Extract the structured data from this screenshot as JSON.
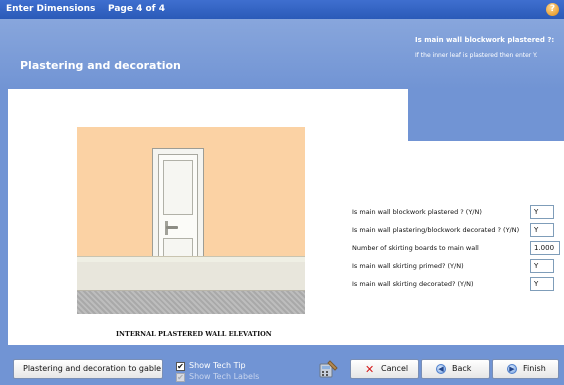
{
  "window": {
    "title": "Enter Dimensions",
    "page_indicator": "Page 4 of 4",
    "help_label": "?"
  },
  "header": {
    "section_title": "Plastering and decoration",
    "tip_title": "Is main wall blockwork plastered ?:",
    "tip_text": "If the inner leaf is plastered then enter Y."
  },
  "illustration": {
    "caption": "INTERNAL PLASTERED WALL ELEVATION",
    "wall_color": "#fbd2a4"
  },
  "form": {
    "rows": [
      {
        "label": "Is main wall blockwork plastered ? (Y/N)",
        "value": "Y"
      },
      {
        "label": "Is main wall plastering/blockwork decorated ? (Y/N)",
        "value": "Y"
      },
      {
        "label": "Number of skirting boards to main wall",
        "value": "1.000"
      },
      {
        "label": "Is main wall skirting primed? (Y/N)",
        "value": "Y"
      },
      {
        "label": "Is main wall skirting decorated? (Y/N)",
        "value": "Y"
      }
    ]
  },
  "footer": {
    "gable_button": "Plastering and decoration to gable",
    "show_tech_tip": {
      "label": "Show Tech Tip",
      "checked": true
    },
    "show_tech_labels": {
      "label": "Show Tech Labels",
      "checked": true
    },
    "cancel_button": "Cancel",
    "back_button": "Back",
    "finish_button": "Finish",
    "check_mark": "✔",
    "cancel_icon": "✕",
    "back_icon": "◀",
    "finish_icon": "▶"
  },
  "colors": {
    "title_bar": "#2a5ab8",
    "background": "#7194d4",
    "accent_cancel": "#d41a1a"
  }
}
